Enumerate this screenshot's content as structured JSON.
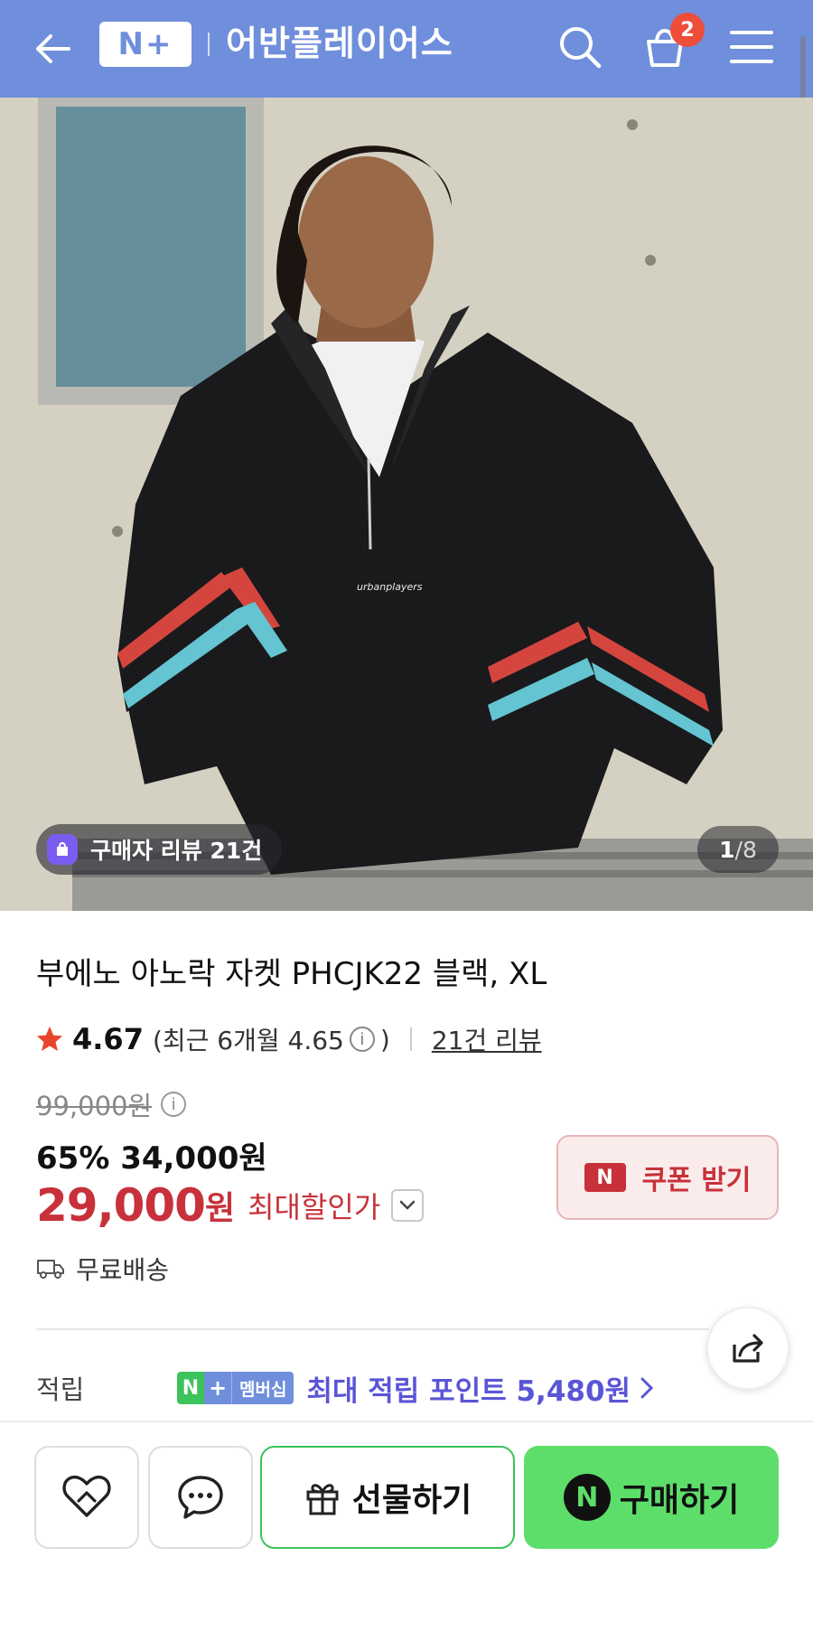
{
  "header": {
    "logo_text": "N+",
    "store_name": "어반플레이어스",
    "cart_count": "2",
    "bg_color": "#6f8edb"
  },
  "hero": {
    "chest_logo": "urbanplayers",
    "review_chip": "구매자 리뷰 21건",
    "page_current": "1",
    "page_total": "/8"
  },
  "product": {
    "title": "부에노 아노락 자켓 PHCJK22 블랙, XL",
    "rating": "4.67",
    "recent_rating_text": "(최근 6개월 4.65",
    "recent_rating_close": ")",
    "review_link": "21건 리뷰",
    "original_price": "99,000원",
    "discount_line": "65% 34,000원",
    "max_price": "29,000",
    "max_price_unit": "원",
    "max_price_label": "최대할인가",
    "coupon_badge": "N",
    "coupon_label": "쿠폰 받기",
    "shipping": "무료배송",
    "points_label": "적립",
    "membership_badge": "멤버십",
    "points_text": "최대 적립 포인트 5,480원"
  },
  "bottom_bar": {
    "gift_label": "선물하기",
    "buy_label": "구매하기",
    "buy_mark": "N"
  },
  "colors": {
    "accent_red": "#c8313a",
    "naver_green": "#5dde6a",
    "points_purple": "#5a55d6"
  },
  "icons": [
    "back-arrow-icon",
    "search-icon",
    "cart-icon",
    "menu-icon",
    "shopping-bag-icon",
    "info-icon",
    "star-icon",
    "chevron-down-icon",
    "truck-icon",
    "share-icon",
    "chevron-right-icon",
    "heart-icon",
    "chat-icon",
    "gift-icon"
  ]
}
